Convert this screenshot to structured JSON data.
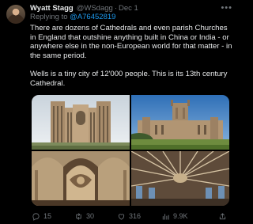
{
  "author": {
    "name": "Wyatt Stagg",
    "handle": "@WSdagg",
    "date": "Dec 1"
  },
  "reply": {
    "prefix": "Replying to",
    "handle": "@A76452819"
  },
  "body": {
    "paragraph_1": "There are dozens of Cathedrals and even parish Churches in England that outshine anything built in China or India - or anywhere else in the non-European world for that matter - in the same period.",
    "paragraph_2": "Wells is a tiny city of 12'000 people. This is its 13th century Cathedral."
  },
  "actions": {
    "replies": "15",
    "reposts": "30",
    "likes": "316",
    "views": "9.9K"
  },
  "icons": {
    "more": "more-options-icon",
    "reply": "reply-icon",
    "repost": "repost-icon",
    "like": "heart-icon",
    "views": "views-icon",
    "share": "share-icon"
  },
  "colors": {
    "background": "#000000",
    "text": "#e7e9ea",
    "muted": "#71767b",
    "link": "#1d9bf0"
  }
}
